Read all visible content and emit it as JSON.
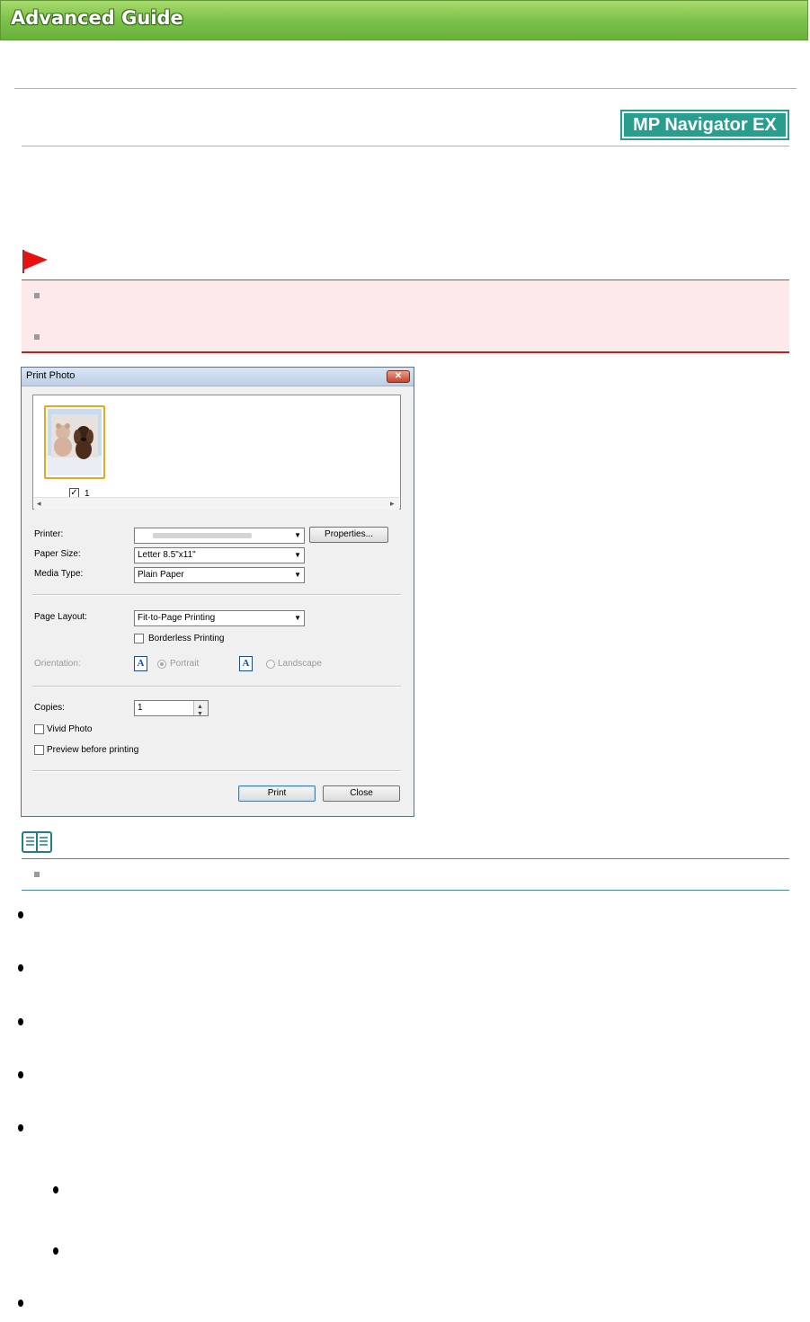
{
  "header": {
    "title": "Advanced Guide"
  },
  "app_badge": {
    "label": "MP Navigator EX"
  },
  "icons": {
    "flag": "important-flag-icon",
    "note": "note-book-icon",
    "close": "close-icon"
  },
  "colors": {
    "banner_green": "#7cc24a",
    "important_bg": "#fde9e9",
    "important_border": "#c41e1e",
    "note_border": "#3f8f9a",
    "badge_teal": "#2a9e8e",
    "selection_orange": "#f3a41a"
  },
  "dialog": {
    "title": "Print Photo",
    "close_glyph": "✕",
    "thumbnail": {
      "number": "1",
      "checked": true,
      "check_glyph": "✓"
    },
    "scroll_left": "◂",
    "scroll_right": "▸",
    "printer": {
      "label": "Printer:",
      "value": ""
    },
    "properties_button": "Properties...",
    "paper_size": {
      "label": "Paper Size:",
      "value": "Letter 8.5\"x11\""
    },
    "media_type": {
      "label": "Media Type:",
      "value": "Plain Paper"
    },
    "page_layout": {
      "label": "Page Layout:",
      "value": "Fit-to-Page Printing"
    },
    "borderless": {
      "label": "Borderless Printing",
      "checked": false
    },
    "orientation": {
      "label": "Orientation:",
      "icon_glyph": "A",
      "portrait": "Portrait",
      "landscape": "Landscape",
      "selected": "Portrait"
    },
    "copies": {
      "label": "Copies:",
      "value": "1",
      "up_glyph": "▲",
      "down_glyph": "▼"
    },
    "vivid_photo": {
      "label": "Vivid Photo",
      "checked": false
    },
    "preview": {
      "label": "Preview before printing",
      "checked": false
    },
    "combo_arrow": "▼",
    "print_button": "Print",
    "close_button": "Close"
  }
}
